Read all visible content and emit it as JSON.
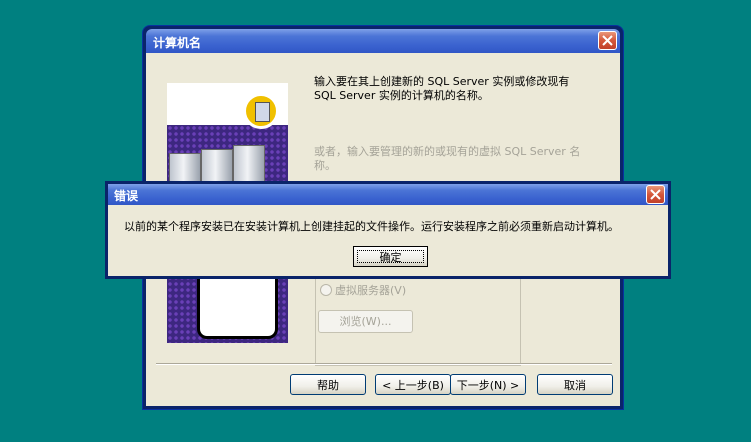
{
  "background_color": "#008080",
  "main_dialog": {
    "title": "计算机名",
    "description": "输入要在其上创建新的 SQL Server 实例或修改现有 SQL Server 实例的计算机的名称。",
    "alt_description": "或者，输入要管理的新的或现有的虚拟 SQL Server 名称。",
    "virtual_server_option": "虚拟服务器(V)",
    "browse_button": "浏览(W)...",
    "buttons": {
      "help": "帮助",
      "back": "< 上一步(B)",
      "next": "下一步(N) >",
      "cancel": "取消"
    }
  },
  "error_dialog": {
    "title": "错误",
    "message": "以前的某个程序安装已在安装计算机上创建挂起的文件操作。运行安装程序之前必须重新启动计算机。",
    "ok_button": "确定"
  }
}
